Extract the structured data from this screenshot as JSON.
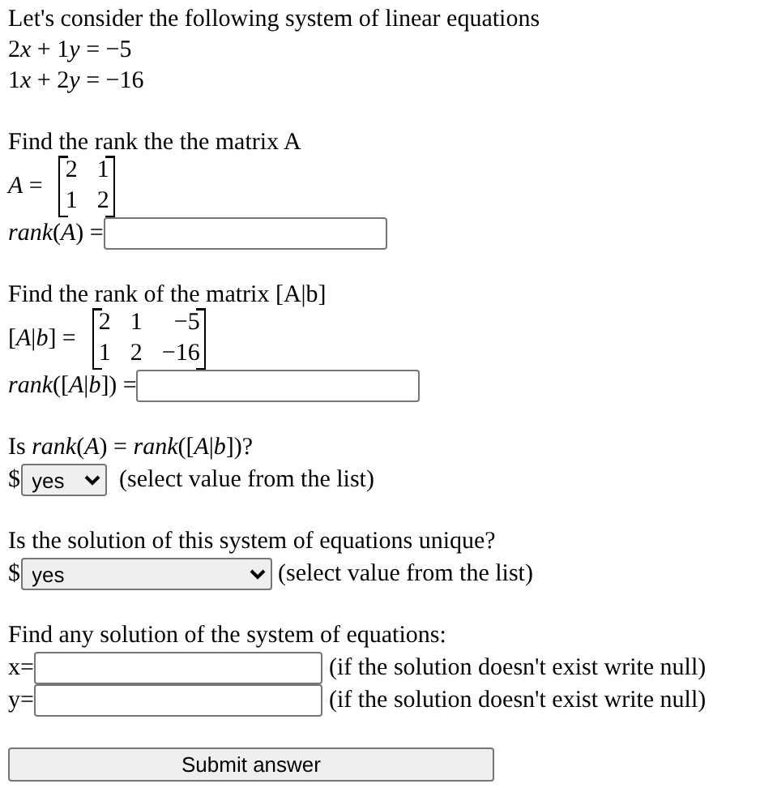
{
  "intro": "Let's consider the following system of linear equations",
  "equations": [
    [
      "2",
      "x",
      " + 1",
      "y",
      " = −5"
    ],
    [
      "1",
      "x",
      " + 2",
      "y",
      " = −16"
    ]
  ],
  "sections": [
    {
      "kind": "rank",
      "title": "Find the rank the the matrix A",
      "matrix_label": "*A* =",
      "matrix": [
        [
          "2",
          "1"
        ],
        [
          "1",
          "2"
        ]
      ],
      "answer_label": "*rank*(*A*) ="
    },
    {
      "kind": "rank",
      "title": "Find the rank of the matrix [A|b]",
      "matrix_label": "[*A*|*b*] =",
      "matrix": [
        [
          "2",
          "1",
          "−5"
        ],
        [
          "1",
          "2",
          "−16"
        ]
      ],
      "answer_label": "*rank*([*A*|*b*]) ="
    },
    {
      "kind": "select",
      "title": "Is *rank*(*A*) = *rank*([*A*|*b*])?",
      "prefix": "$",
      "value": "yes",
      "wide": false,
      "hint": "(select value from the list)"
    },
    {
      "kind": "select",
      "title": "Is the solution of this system of equations unique?",
      "prefix": "$",
      "value": "yes",
      "wide": true,
      "hint": "(select value from the list)"
    },
    {
      "kind": "fields",
      "title": "Find any solution of the system of equations:",
      "fields": [
        {
          "label": "x=",
          "hint": "(if the solution doesn't exist write null)"
        },
        {
          "label": "y=",
          "hint": "(if the solution doesn't exist write null)"
        }
      ]
    }
  ],
  "submit": "Submit answer"
}
